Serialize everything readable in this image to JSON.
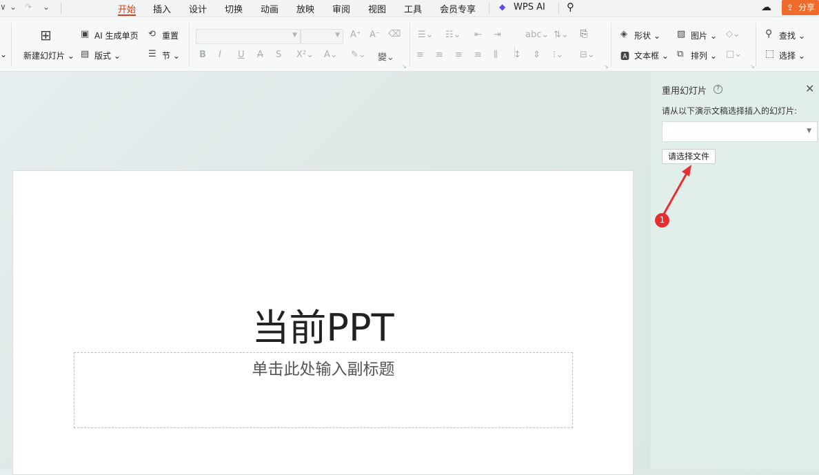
{
  "menubar": {
    "items": [
      "开始",
      "插入",
      "设计",
      "切换",
      "动画",
      "放映",
      "审阅",
      "视图",
      "工具",
      "会员专享"
    ],
    "active": "开始",
    "wps_ai": "WPS AI",
    "share": "分享"
  },
  "ribbon": {
    "new_slide": "新建幻灯片",
    "ai_single_page": "AI 生成单页",
    "layout": "版式",
    "reset": "重置",
    "section": "节",
    "shape": "形状",
    "picture": "图片",
    "textbox": "文本框",
    "arrange": "排列",
    "find": "查找",
    "select": "选择",
    "font_name": "",
    "font_size": ""
  },
  "slide": {
    "title": "当前PPT",
    "subtitle_placeholder": "单击此处输入副标题"
  },
  "panel": {
    "title": "重用幻灯片",
    "label": "请从以下演示文稿选择插入的幻灯片:",
    "select_value": "",
    "choose_file_button": "请选择文件"
  },
  "annotation": {
    "badge_number": "1",
    "color": "#e62e2e"
  },
  "colors": {
    "accent": "#c7411f",
    "share_button": "#ee6b2c"
  }
}
